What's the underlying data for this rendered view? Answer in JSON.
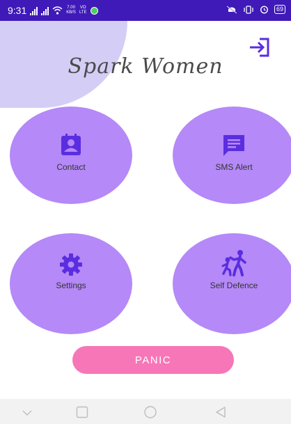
{
  "status_bar": {
    "time": "9:31",
    "speed_value": "7.00",
    "speed_unit": "KB/S",
    "volte_top": "VO",
    "volte_bottom": "LTE",
    "battery": "69",
    "background": "#3f1ab8"
  },
  "header": {
    "title": "Spark Women",
    "logout_icon": "logout-arrow-icon"
  },
  "tiles": [
    {
      "label": "Contact",
      "icon": "contact-icon"
    },
    {
      "label": "SMS Alert",
      "icon": "message-icon"
    },
    {
      "label": "Settings",
      "icon": "gear-icon"
    },
    {
      "label": "Self Defence",
      "icon": "self-defence-icon"
    }
  ],
  "panic": {
    "label": "PANIC",
    "color": "#f776b8"
  },
  "colors": {
    "accent": "#5b2de0",
    "tile": "#b589f7",
    "corner": "#d4cef6"
  },
  "nav_bar": {
    "buttons": [
      "chevron-down-icon",
      "square-icon",
      "circle-icon",
      "triangle-back-icon"
    ]
  }
}
